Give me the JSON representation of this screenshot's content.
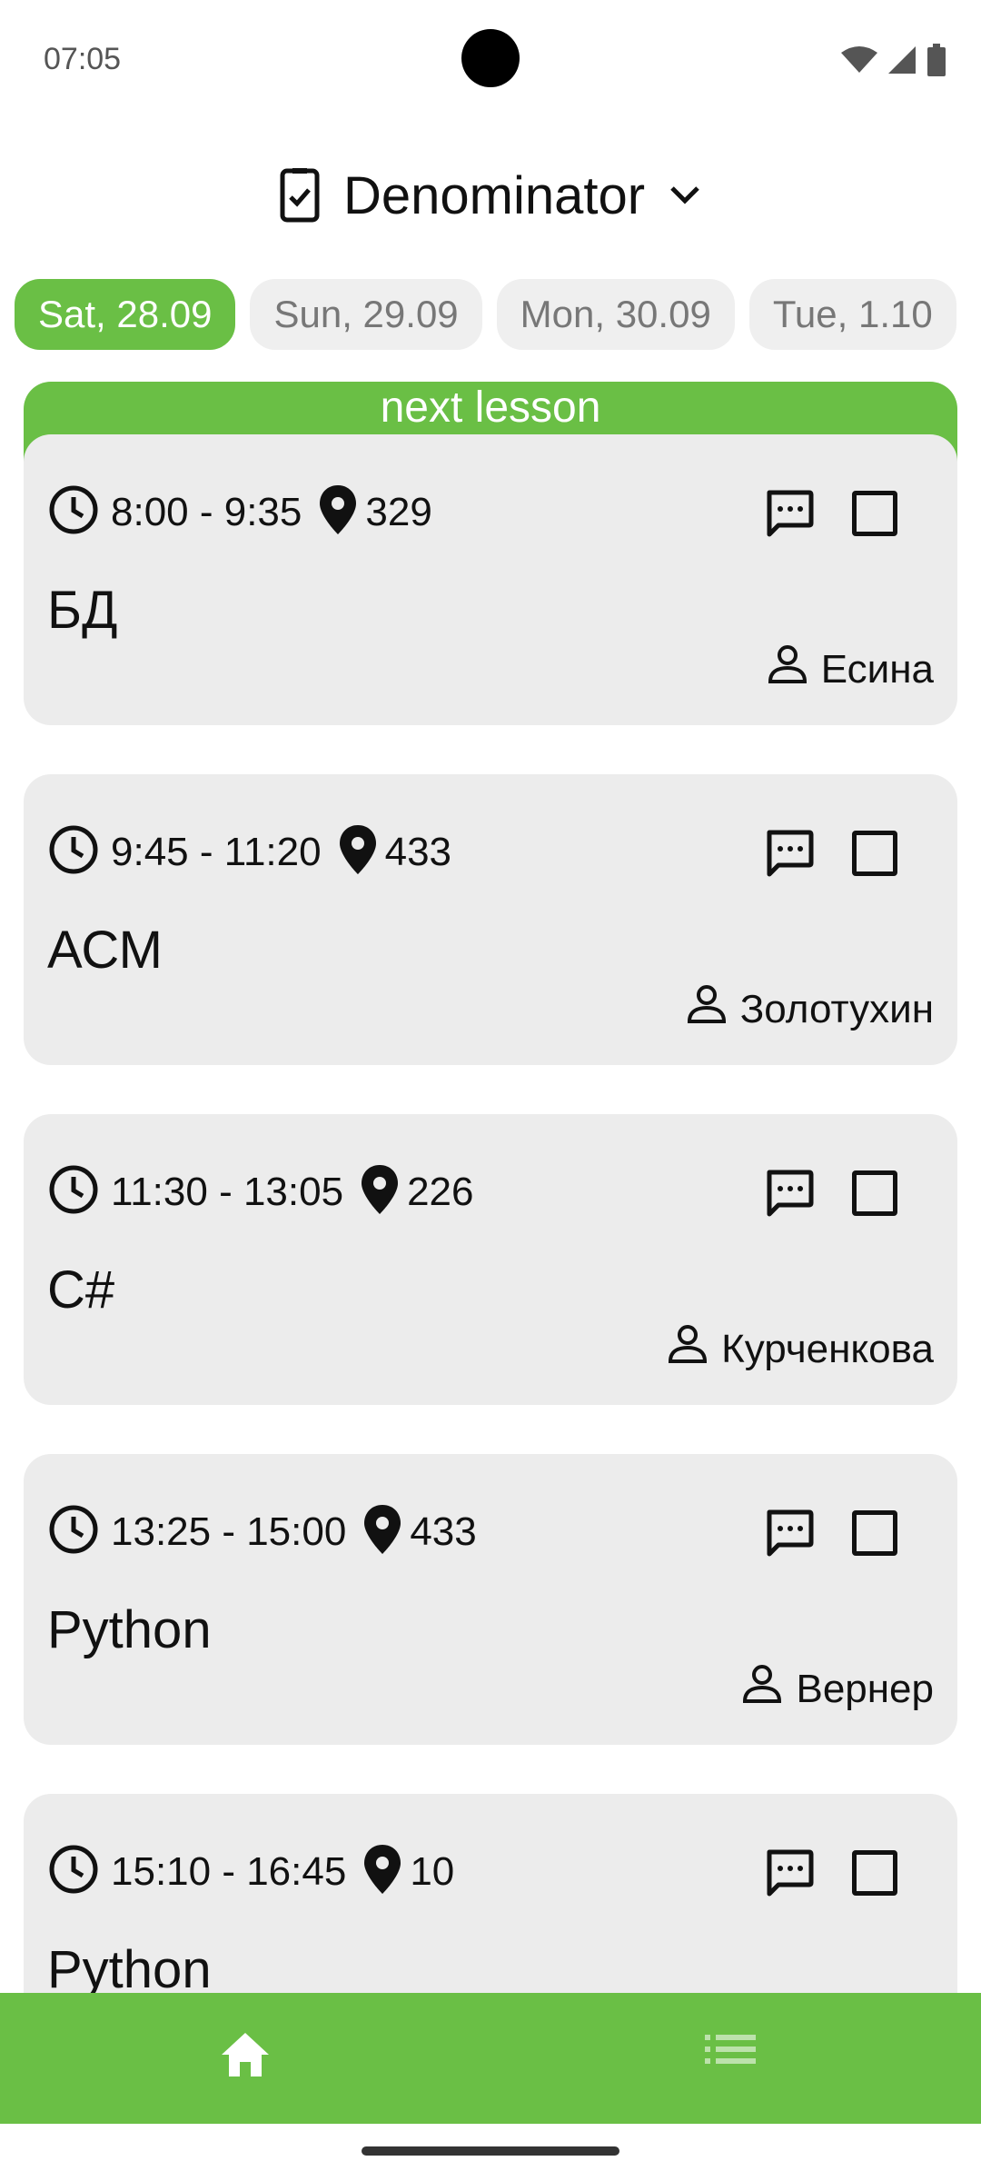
{
  "status": {
    "time": "07:05"
  },
  "header": {
    "title": "Denominator"
  },
  "days": [
    {
      "label": "Sat, 28.09",
      "active": true
    },
    {
      "label": "Sun, 29.09",
      "active": false
    },
    {
      "label": "Mon, 30.09",
      "active": false
    },
    {
      "label": "Tue, 1.10",
      "active": false
    }
  ],
  "next_banner": {
    "label": "next lesson"
  },
  "lessons": [
    {
      "time": "8:00 - 9:35",
      "room": "329",
      "subject": "БД",
      "teacher": "Есина"
    },
    {
      "time": "9:45 - 11:20",
      "room": "433",
      "subject": "АСМ",
      "teacher": "Золотухин"
    },
    {
      "time": "11:30 - 13:05",
      "room": "226",
      "subject": "C#",
      "teacher": "Курченкова"
    },
    {
      "time": "13:25 - 15:00",
      "room": "433",
      "subject": "Python",
      "teacher": "Вернер"
    },
    {
      "time": "15:10 - 16:45",
      "room": "10",
      "subject": "Python",
      "teacher": ""
    }
  ],
  "colors": {
    "accent": "#6abf45",
    "card": "#ececec",
    "chip": "#efefef"
  },
  "icons": {
    "header_left": "phone-check-icon",
    "header_right": "chevron-down-icon",
    "time": "clock-icon",
    "room": "location-pin-icon",
    "teacher": "person-icon",
    "note": "message-icon",
    "check": "checkbox-icon",
    "nav_home": "home-icon",
    "nav_list": "list-icon"
  }
}
